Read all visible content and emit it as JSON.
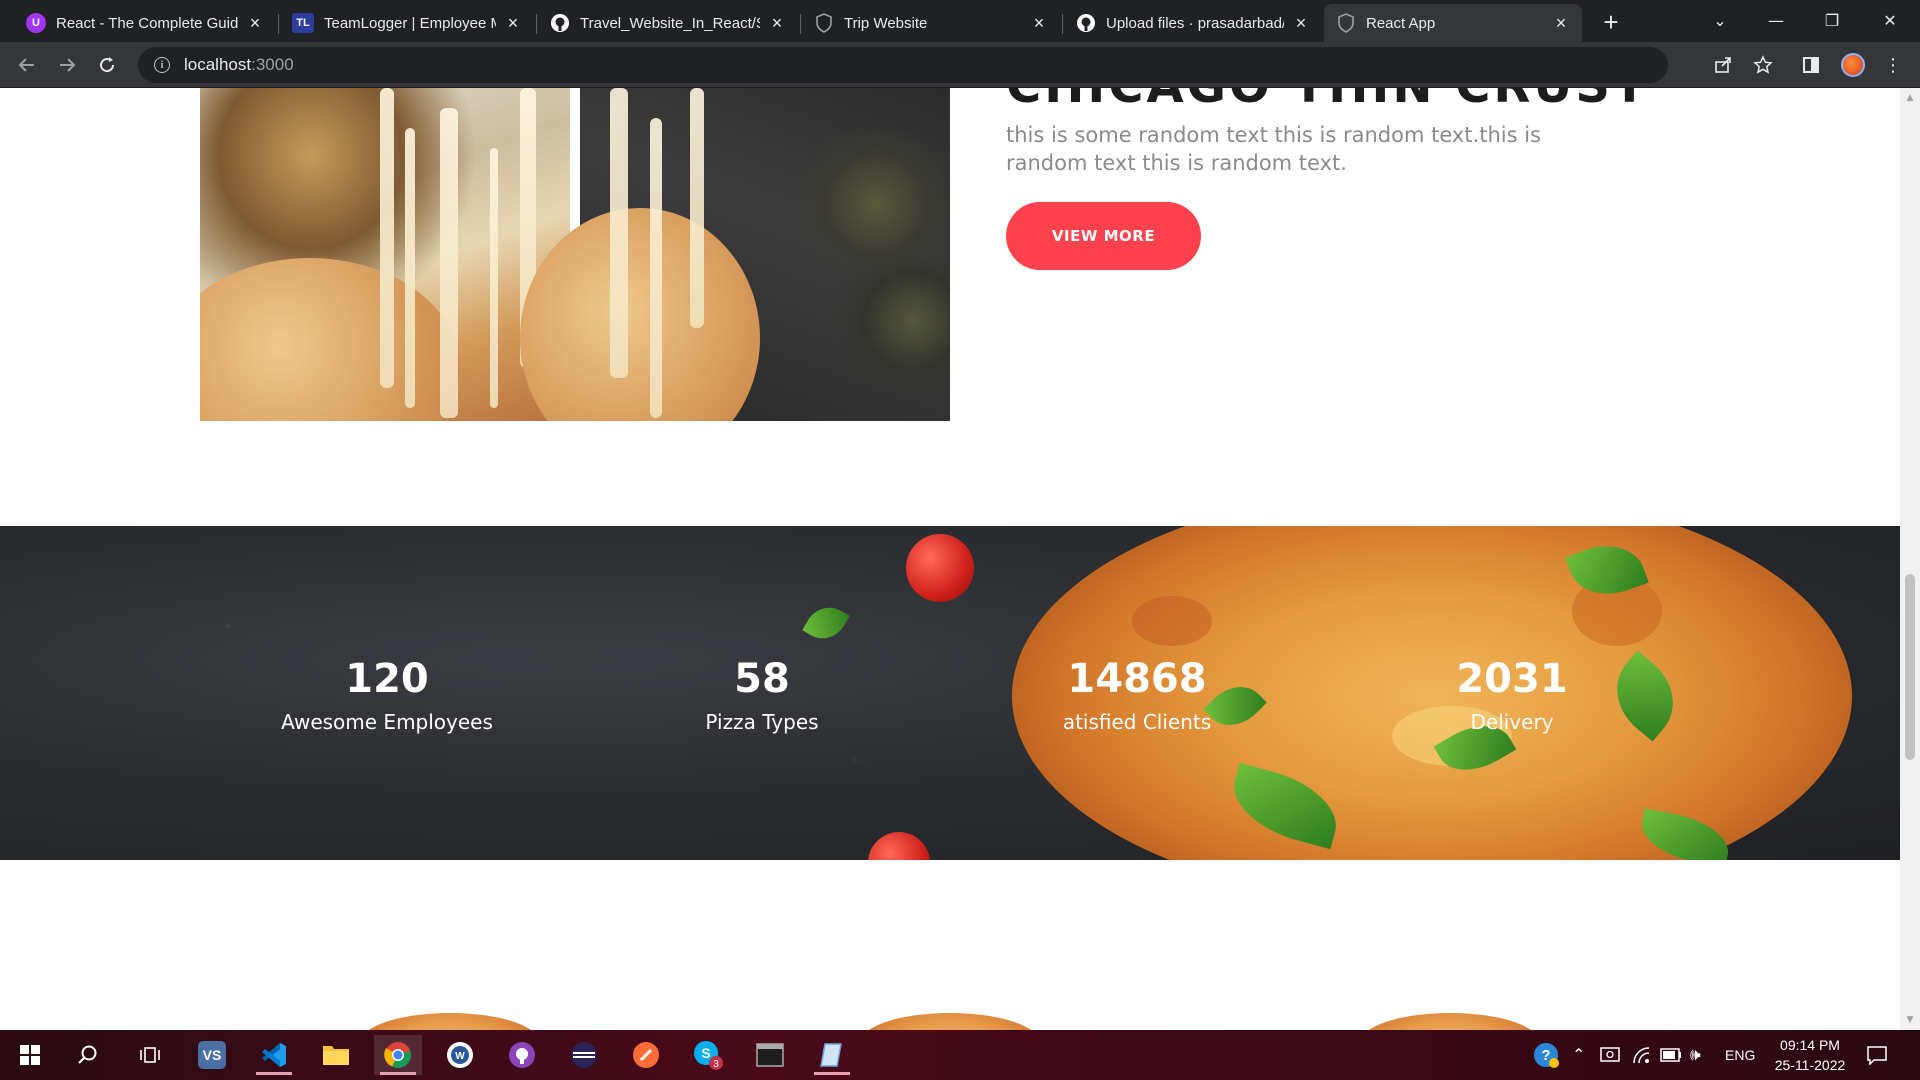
{
  "browser": {
    "tabs": [
      {
        "label": "React - The Complete Guid",
        "favicon": "U",
        "favicon_color": "#a435f0"
      },
      {
        "label": "TeamLogger | Employee Mo",
        "favicon": "TL",
        "favicon_color": "#2b3e9c"
      },
      {
        "label": "Travel_Website_In_React/Sc",
        "favicon": "github-icon",
        "favicon_color": "#ffffff"
      },
      {
        "label": "Trip Website",
        "favicon": "shield-icon",
        "favicon_color": "#9aa0a6"
      },
      {
        "label": "Upload files · prasadarbad/",
        "favicon": "github-icon",
        "favicon_color": "#ffffff"
      },
      {
        "label": "React App",
        "favicon": "shield-icon",
        "favicon_color": "#9aa0a6"
      }
    ],
    "active_tab": "React App",
    "new_tab_glyph": "+",
    "url_host": "localhost",
    "url_port": ":3000"
  },
  "page": {
    "section_heading": "CHICAGO THIN CRUST",
    "description": "this is some random text this is random text.this is random text this is random text.",
    "view_more_label": "VIEW MORE",
    "accent_color": "#fe424d",
    "stats": [
      {
        "value": "120",
        "label": "Awesome Employees"
      },
      {
        "value": "58",
        "label": "Pizza Types"
      },
      {
        "value": "14868",
        "label": "atisfied Clients"
      },
      {
        "value": "2031",
        "label": "Delivery"
      }
    ]
  },
  "taskbar": {
    "apps": [
      "windows-start-icon",
      "search-icon",
      "task-view-icon",
      "visual-studio-icon",
      "vscode-icon",
      "file-explorer-icon",
      "chrome-icon",
      "word-icon",
      "github-desktop-icon",
      "eclipse-icon",
      "postman-icon",
      "skype-icon",
      "terminal-icon",
      "notepad-icon"
    ],
    "skype_badge": "3",
    "language": "ENG",
    "time": "09:14 PM",
    "date": "25-11-2022"
  }
}
